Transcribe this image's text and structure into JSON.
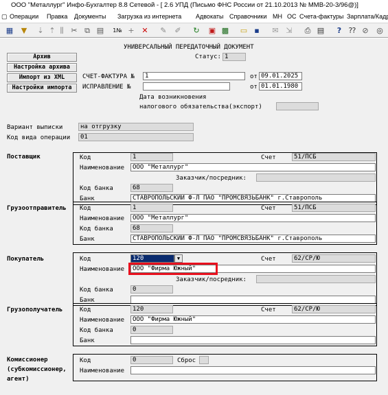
{
  "window": {
    "title": "ООО \"Металлург\" Инфо-Бухгалтер 8.8 Сетевой - [  2.6 УПД (Письмо ФНС России от 21.10.2013 № ММВ-20-3/96@)]"
  },
  "menu": {
    "items": [
      "Операции",
      "Правка",
      "Документы",
      "Загрузка из интернета",
      "Адвокаты",
      "Справочники",
      "МН",
      "ОС",
      "Счета-фактуры",
      "Зарплата/Кадр"
    ]
  },
  "toolbar": {
    "icons": [
      "table-icon",
      "filter-icon",
      "sort-icon",
      "sort-desc-icon",
      "split-icon",
      "cut-icon",
      "copy-icon",
      "paste-icon",
      "numbering-icon",
      "add-icon",
      "delete-icon",
      "mark-icon",
      "unmark-icon",
      "refresh-icon",
      "pdf-icon",
      "calculator-icon",
      "open-icon",
      "save-icon",
      "mail-icon",
      "export-icon",
      "print-icon",
      "preview-icon",
      "help-icon",
      "context-help-icon",
      "settings-icon",
      "exit-icon"
    ]
  },
  "doc": {
    "heading": "УНИВЕРСАЛЬНЫЙ ПЕРЕДАТОЧНЫЙ ДОКУМЕНТ",
    "status_label": "Статус:",
    "status_value": "1",
    "buttons": [
      "Архив",
      "Настройка архива",
      "Импорт из XML",
      "Настройки импорта"
    ],
    "invoice_label": "СЧЕТ-ФАКТУРА №",
    "invoice_number": "1",
    "date_from_label": "от",
    "invoice_date": "09.01.2025",
    "correction_label": "ИСПРАВЛЕНИЕ  №",
    "correction_number": "",
    "correction_date": "01.01.1980",
    "tax_date_label_1": "Дата возникновения",
    "tax_date_label_2": "налогового обязательства(экспорт)",
    "tax_date_value": "",
    "variant_label": "Вариант выписки",
    "variant_value": "на отгрузку",
    "operation_label": "Код вида операции",
    "operation_value": "01"
  },
  "labels": {
    "code": "Код",
    "name": "Наименование",
    "account": "Счет",
    "bank_code": "Код банка",
    "bank": "Банк",
    "customer": "Заказчик/посредник:",
    "reset": "Сброс"
  },
  "supplier": {
    "section": "Поставщик",
    "code": "1",
    "account": "51/ПСБ",
    "name": "ООО \"Металлург\"",
    "customer": "",
    "bank_code": "68",
    "bank": "СТАВРОПОЛЬСКИЙ Ф-Л ПАО \"ПРОМСВЯЗЬБАНК\" г.Ставрополь"
  },
  "shipper": {
    "section": "Грузоотправитель",
    "code": "1",
    "account": "51/ПСБ",
    "name": "ООО \"Металлург\"",
    "bank_code": "68",
    "bank": "СТАВРОПОЛЬСКИЙ Ф-Л ПАО \"ПРОМСВЯЗЬБАНК\" г.Ставрополь"
  },
  "buyer": {
    "section": "Покупатель",
    "code": "120",
    "account": "62/СР/Ю",
    "name": "ООО \"Фирма Южный\"",
    "customer": "",
    "bank_code": "0",
    "bank": ""
  },
  "consignee": {
    "section": "Грузополучатель",
    "code": "120",
    "account": "62/СР/Ю",
    "name": "ООО \"Фирма Южный\"",
    "bank_code": "0",
    "bank": ""
  },
  "commissioner": {
    "section_1": "Комиссионер",
    "section_2": "(субкомиссионер,",
    "section_3": "агент)",
    "code": "0",
    "reset_value": "",
    "name": ""
  }
}
